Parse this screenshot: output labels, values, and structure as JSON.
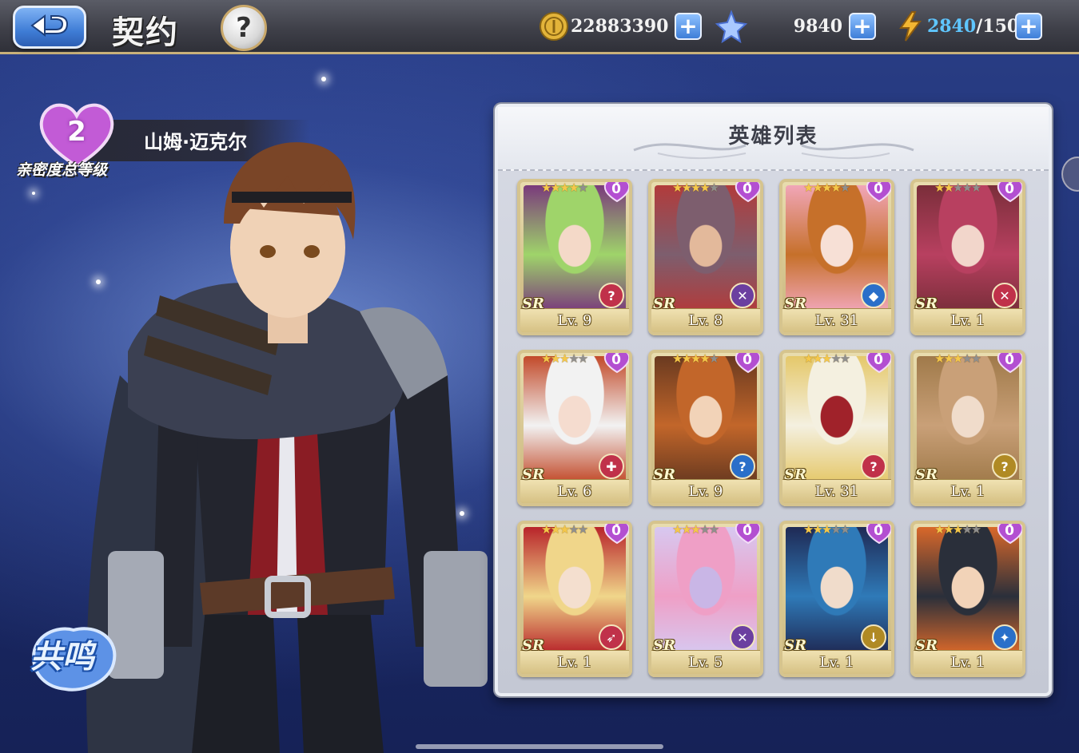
{
  "header": {
    "title": "契约",
    "back_icon": "back-arrow-icon",
    "help_label": "?"
  },
  "resources": {
    "gold": {
      "icon": "gold-coin-icon",
      "value": "22883390"
    },
    "crystal": {
      "icon": "star-crystal-icon",
      "value": "9840"
    },
    "stamina": {
      "icon": "lightning-icon",
      "current": "2840",
      "max": "/150"
    }
  },
  "intimacy": {
    "level": "2",
    "label": "亲密度总等级",
    "hero_name": "山姆·迈克尔"
  },
  "resonate_button": {
    "label": "共鸣"
  },
  "hero_list": {
    "title": "英雄列表",
    "heroes": [
      {
        "stars": 4,
        "intimacy": "0",
        "rarity": "SR",
        "level": "Lv. 9",
        "role": "support",
        "role_color": "#c0314a",
        "palette": [
          "#7a3a7c",
          "#9fd46a",
          "#f4d9c8"
        ]
      },
      {
        "stars": 4,
        "intimacy": "0",
        "rarity": "SR",
        "level": "Lv. 8",
        "role": "melee",
        "role_color": "#6b3fa0",
        "palette": [
          "#b23b3b",
          "#7d5e6e",
          "#e3b99b"
        ]
      },
      {
        "stars": 4,
        "intimacy": "0",
        "rarity": "SR",
        "level": "Lv. 31",
        "role": "tank",
        "role_color": "#2a6fc9",
        "palette": [
          "#f1a6b8",
          "#c6702a",
          "#f7e0d6"
        ]
      },
      {
        "stars": 2,
        "intimacy": "0",
        "rarity": "SR",
        "level": "Lv. 1",
        "role": "melee",
        "role_color": "#c0314a",
        "palette": [
          "#7a2e3a",
          "#b84060",
          "#f2d6cb"
        ]
      },
      {
        "stars": 3,
        "intimacy": "0",
        "rarity": "SR",
        "level": "Lv. 6",
        "role": "healer",
        "role_color": "#c0314a",
        "palette": [
          "#c24a2a",
          "#f2f2f2",
          "#f5dccf"
        ]
      },
      {
        "stars": 4,
        "intimacy": "0",
        "rarity": "SR",
        "level": "Lv. 9",
        "role": "support",
        "role_color": "#2a6fc9",
        "palette": [
          "#6a3a20",
          "#c2662a",
          "#f2d3b8"
        ]
      },
      {
        "stars": 3,
        "intimacy": "0",
        "rarity": "SR",
        "level": "Lv. 31",
        "role": "support",
        "role_color": "#c0314a",
        "palette": [
          "#e5c86a",
          "#f4f0e0",
          "#a0222a"
        ]
      },
      {
        "stars": 3,
        "intimacy": "0",
        "rarity": "SR",
        "level": "Lv. 1",
        "role": "support",
        "role_color": "#b08a24",
        "palette": [
          "#a07a4a",
          "#c9a078",
          "#f0dccb"
        ]
      },
      {
        "stars": 3,
        "intimacy": "0",
        "rarity": "SR",
        "level": "Lv. 1",
        "role": "ranged",
        "role_color": "#c0314a",
        "palette": [
          "#b8242a",
          "#f0d68a",
          "#f4dfcf"
        ]
      },
      {
        "stars": 3,
        "intimacy": "0",
        "rarity": "SR",
        "level": "Lv. 5",
        "role": "melee",
        "role_color": "#6b3fa0",
        "palette": [
          "#d7c8f0",
          "#ef9fc6",
          "#c9b6e6"
        ]
      },
      {
        "stars": 3,
        "intimacy": "0",
        "rarity": "SR",
        "level": "Lv. 1",
        "role": "dps",
        "role_color": "#b08a24",
        "palette": [
          "#1f2a55",
          "#2f7ab8",
          "#f0dccb"
        ]
      },
      {
        "stars": 3,
        "intimacy": "0",
        "rarity": "SR",
        "level": "Lv. 1",
        "role": "mage",
        "role_color": "#2a6fc9",
        "palette": [
          "#d9682a",
          "#2a2f3a",
          "#f2d3b8"
        ]
      }
    ]
  }
}
